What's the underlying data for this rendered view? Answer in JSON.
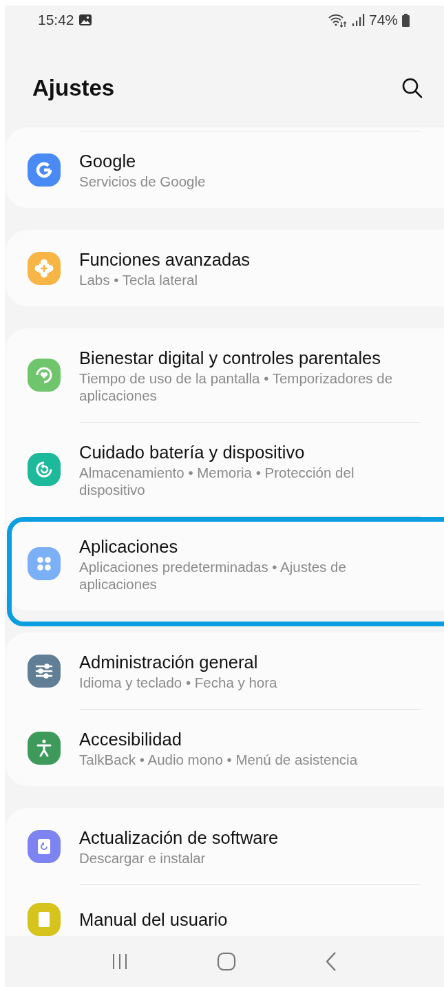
{
  "status_bar": {
    "time": "15:42",
    "battery": "74%"
  },
  "header": {
    "title": "Ajustes"
  },
  "groups": [
    {
      "items": [
        {
          "kind": "google",
          "color": "#4a8af4",
          "title": "Google",
          "subtitle": "Servicios de Google",
          "highlighted": false
        }
      ]
    },
    {
      "items": [
        {
          "kind": "advanced",
          "color": "#f6b544",
          "title": "Funciones avanzadas",
          "subtitle": "Labs • Tecla lateral",
          "highlighted": false
        }
      ]
    },
    {
      "items": [
        {
          "kind": "wellbeing",
          "color": "#6fc56b",
          "title": "Bienestar digital y controles parentales",
          "subtitle": "Tiempo de uso de la pantalla • Temporizadores de aplicaciones",
          "highlighted": false
        },
        {
          "kind": "care",
          "color": "#1db99b",
          "title": "Cuidado batería y dispositivo",
          "subtitle": "Almacenamiento • Memoria • Protección del dispositivo",
          "highlighted": false
        },
        {
          "kind": "apps",
          "color": "#7cb0f6",
          "title": "Aplicaciones",
          "subtitle": "Aplicaciones predeterminadas • Ajustes de aplicaciones",
          "highlighted": true
        }
      ]
    },
    {
      "items": [
        {
          "kind": "general",
          "color": "#607f96",
          "title": "Administración general",
          "subtitle": "Idioma y teclado • Fecha y hora",
          "highlighted": false
        },
        {
          "kind": "accessibility",
          "color": "#3e9a5b",
          "title": "Accesibilidad",
          "subtitle": "TalkBack • Audio mono • Menú de asistencia",
          "highlighted": false
        }
      ]
    },
    {
      "items": [
        {
          "kind": "update",
          "color": "#7d83f1",
          "title": "Actualización de software",
          "subtitle": "Descargar e instalar",
          "highlighted": false
        },
        {
          "kind": "manual",
          "color": "#d6c31c",
          "title": "Manual del usuario",
          "highlighted": false
        }
      ]
    }
  ]
}
